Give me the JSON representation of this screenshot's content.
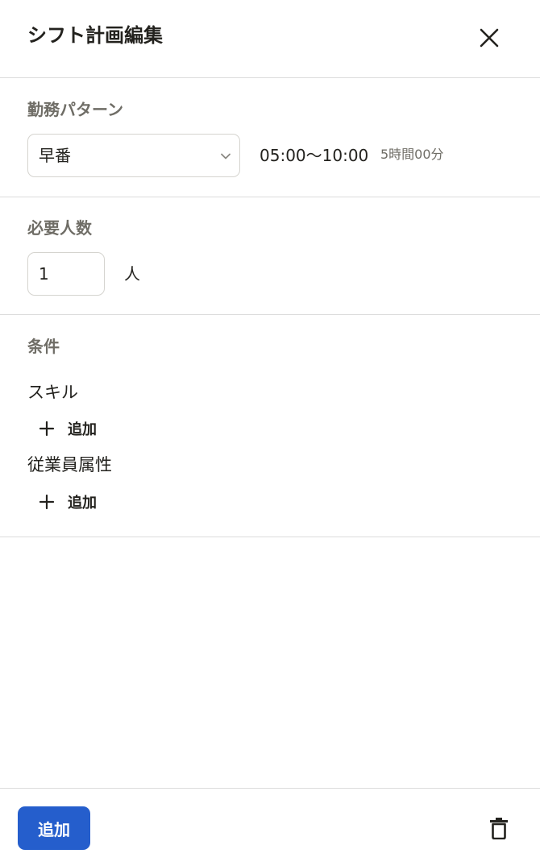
{
  "header": {
    "title": "シフト計画編集",
    "close_icon": "close-icon"
  },
  "work_pattern": {
    "label": "勤務パターン",
    "selected": "早番",
    "time_range": "05:00〜10:00",
    "duration": "5時間00分"
  },
  "required_people": {
    "label": "必要人数",
    "value": "1",
    "unit": "人"
  },
  "conditions": {
    "label": "条件",
    "skill_label": "スキル",
    "skill_add_label": "追加",
    "attribute_label": "従業員属性",
    "attribute_add_label": "追加"
  },
  "footer": {
    "add_button_label": "追加",
    "delete_icon": "trash-icon"
  },
  "colors": {
    "primary": "#255ecc",
    "text": "#23221e",
    "muted": "#6f6d66",
    "border": "#dcdcdc"
  }
}
